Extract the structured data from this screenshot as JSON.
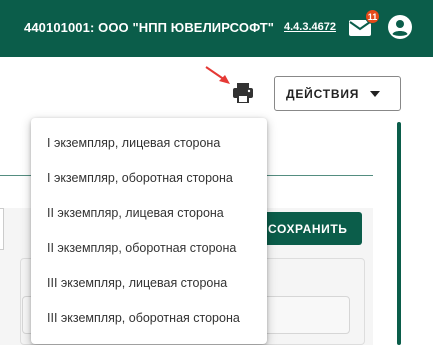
{
  "header": {
    "org_title": "440101001: ООО \"НПП ЮВЕЛИРСОФТ\"",
    "version": "4.4.3.4672",
    "mail_badge": "11",
    "mail_icon": "mail-icon",
    "account_icon": "account-circle-icon"
  },
  "toolbar": {
    "print_icon": "printer-icon",
    "actions_label": "ДЕЙСТВИЯ"
  },
  "content": {
    "save_label": "СОХРАНИТЬ"
  },
  "print_menu": {
    "items": [
      "I экземпляр, лицевая сторона",
      "I экземпляр, оборотная сторона",
      "II экземпляр, лицевая сторона",
      "II экземпляр, оборотная сторона",
      "III экземпляр, лицевая сторона",
      "III экземпляр, оборотная сторона"
    ]
  },
  "colors": {
    "primary": "#0b5d4a",
    "badge": "#e64a19",
    "annotation_arrow": "#e53935"
  }
}
